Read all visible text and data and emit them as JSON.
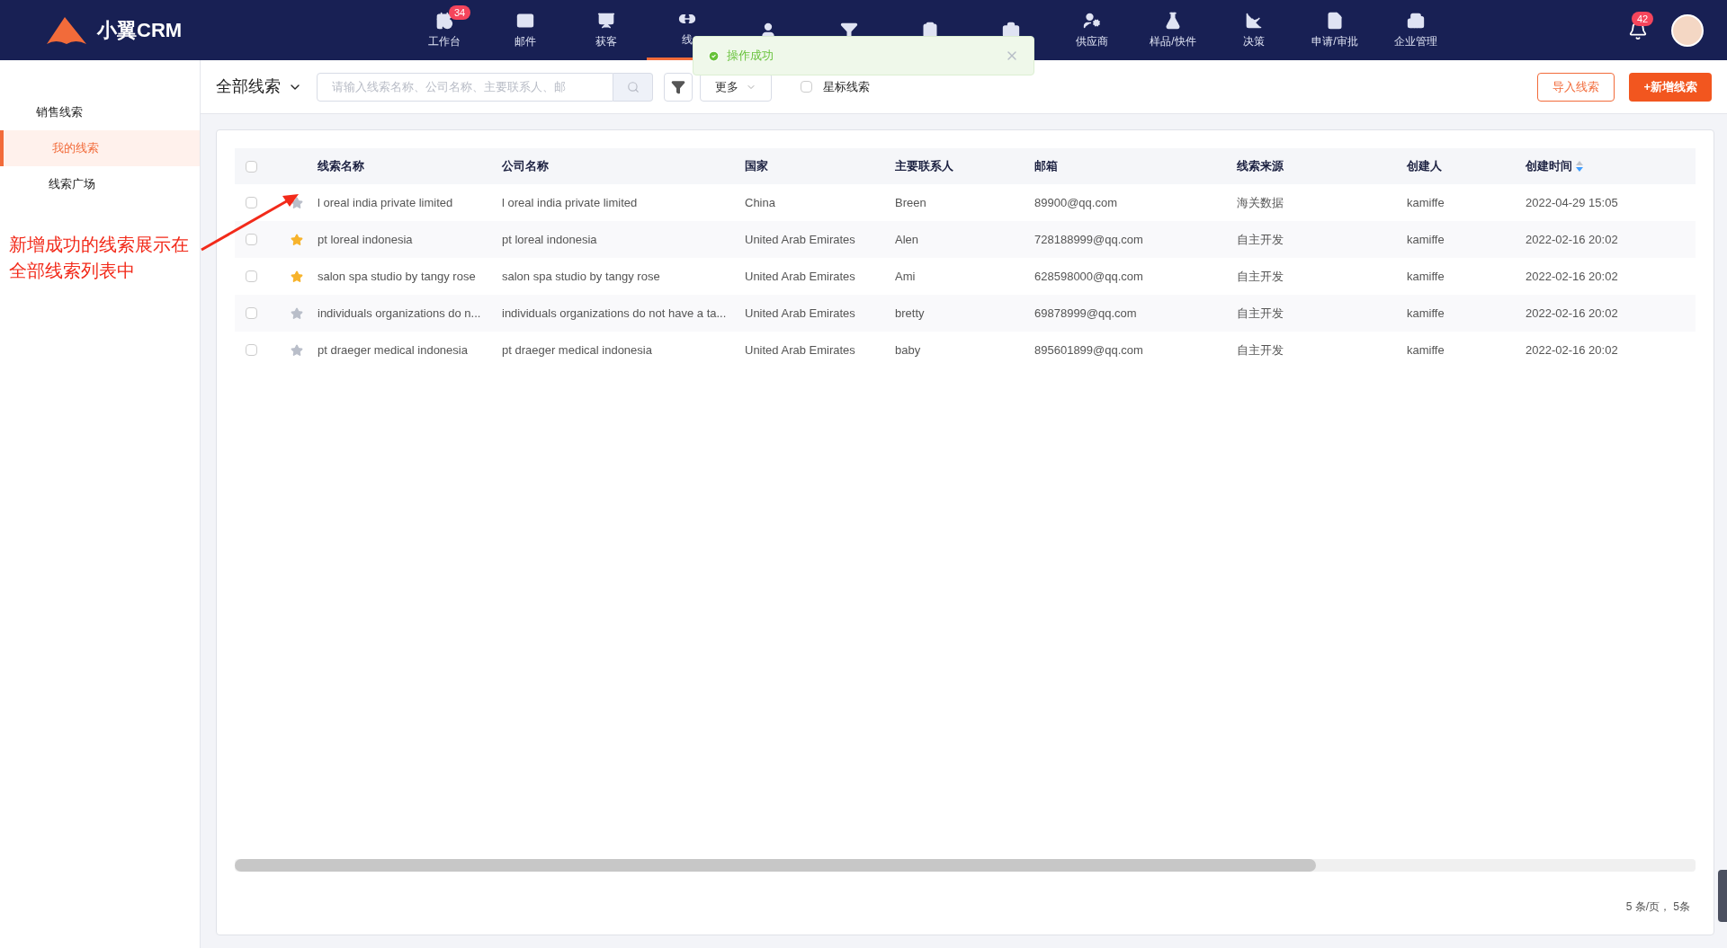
{
  "logo": {
    "text": "小翼CRM"
  },
  "nav": [
    {
      "label": "工作台",
      "badge": "34",
      "selected": false
    },
    {
      "label": "邮件",
      "selected": false
    },
    {
      "label": "获客",
      "selected": false
    },
    {
      "label": "线",
      "selected": true
    },
    {
      "selected": false
    },
    {
      "selected": false
    },
    {
      "selected": false
    },
    {
      "selected": false
    },
    {
      "label": "供应商",
      "selected": false
    },
    {
      "label": "样品/快件",
      "selected": false
    },
    {
      "label": "决策",
      "selected": false
    },
    {
      "label": "申请/审批",
      "selected": false
    },
    {
      "label": "企业管理",
      "selected": false
    }
  ],
  "notifications": {
    "badge": "42"
  },
  "toast": {
    "message": "操作成功"
  },
  "sidebar": {
    "title": "销售线索",
    "items": [
      {
        "label": "我的线索",
        "selected": true
      },
      {
        "label": "线索广场",
        "selected": false
      }
    ]
  },
  "toolbar": {
    "view": "全部线索",
    "search": {
      "placeholder": "请输入线索名称、公司名称、主要联系人、邮"
    },
    "more": "更多",
    "starred_filter": {
      "label": "星标线索",
      "checked": false
    },
    "import_button": "导入线索",
    "add_button": "+新增线索"
  },
  "table": {
    "select_all_checked": false,
    "columns": [
      "线索名称",
      "公司名称",
      "国家",
      "主要联系人",
      "邮箱",
      "线索来源",
      "创建人",
      "创建时间"
    ],
    "rows": [
      {
        "checked": false,
        "starred": false,
        "cells": [
          "l oreal india private limited",
          "l oreal india private limited",
          "China",
          "Breen",
          "89900@qq.com",
          "海关数据",
          "kamiffe",
          "2022-04-29 15:05"
        ]
      },
      {
        "checked": false,
        "starred": true,
        "cells": [
          "pt loreal indonesia",
          "pt loreal indonesia",
          "United Arab Emirates",
          "Alen",
          "728188999@qq.com",
          "自主开发",
          "kamiffe",
          "2022-02-16 20:02"
        ]
      },
      {
        "checked": false,
        "starred": true,
        "cells": [
          "salon spa studio by tangy rose",
          "salon spa studio by tangy rose",
          "United Arab Emirates",
          "Ami",
          "628598000@qq.com",
          "自主开发",
          "kamiffe",
          "2022-02-16 20:02"
        ]
      },
      {
        "checked": false,
        "starred": false,
        "cells": [
          "individuals organizations do n...",
          "individuals organizations do not have a ta...",
          "United Arab Emirates",
          "bretty",
          "69878999@qq.com",
          "自主开发",
          "kamiffe",
          "2022-02-16 20:02"
        ]
      },
      {
        "checked": false,
        "starred": false,
        "cells": [
          "pt draeger medical indonesia",
          "pt draeger medical indonesia",
          "United Arab Emirates",
          "baby",
          "895601899@qq.com",
          "自主开发",
          "kamiffe",
          "2022-02-16 20:02"
        ]
      }
    ]
  },
  "pagination": "5 条/页， 5条",
  "annotation": "新增成功的线索展示在全部线索列表中"
}
